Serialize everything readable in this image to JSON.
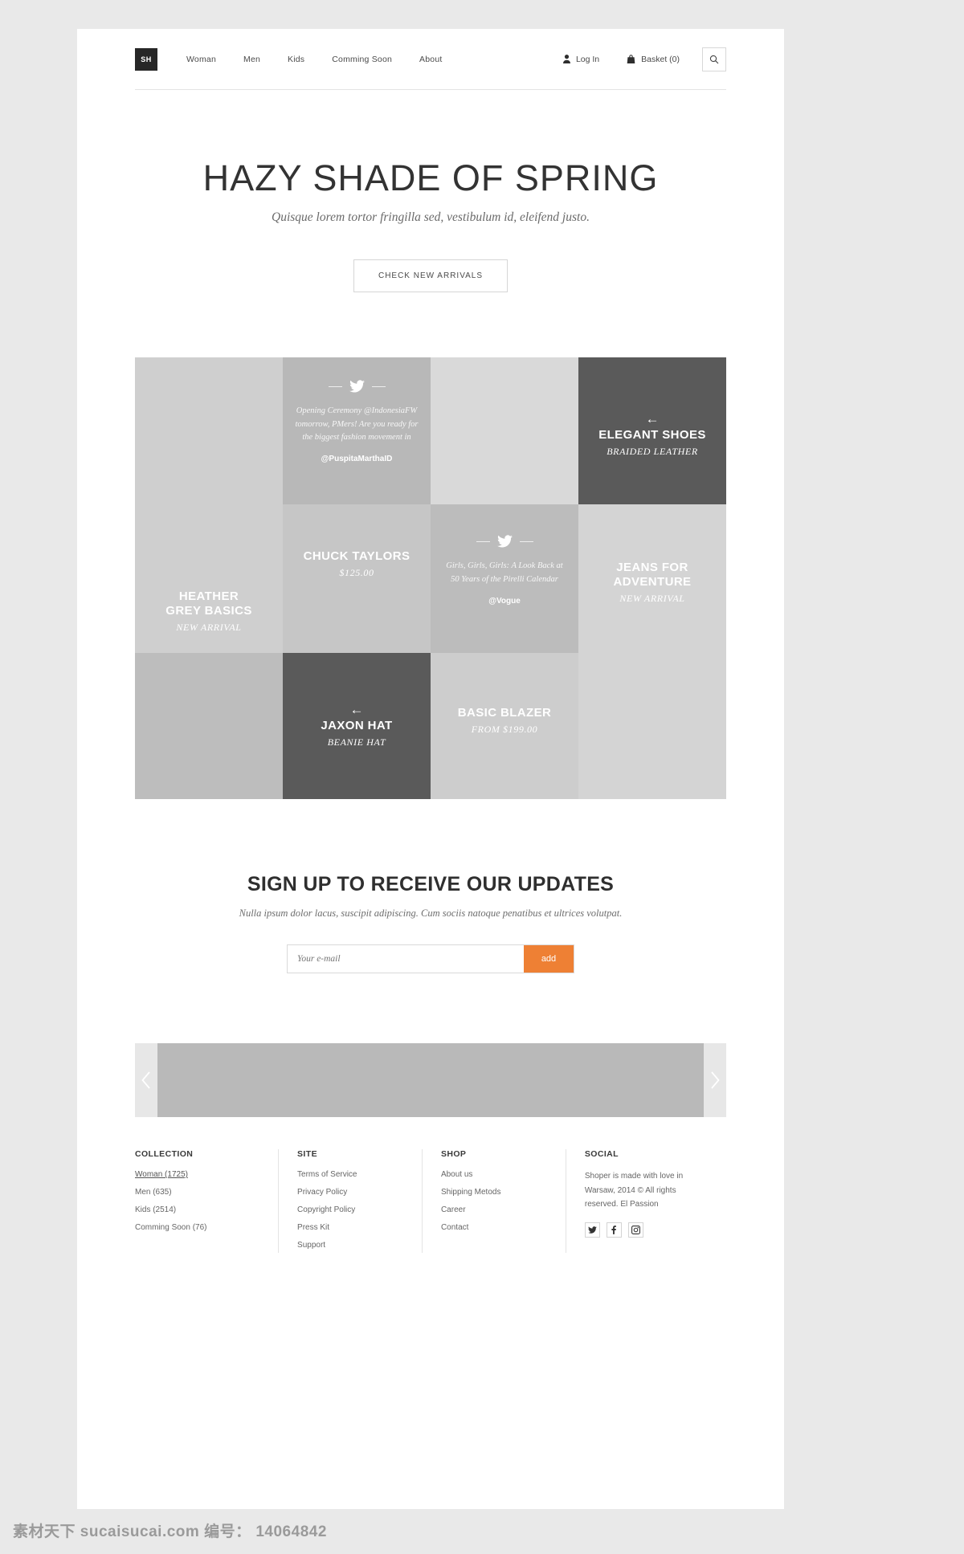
{
  "header": {
    "logo": "SH",
    "nav": [
      {
        "label": "Woman"
      },
      {
        "label": "Men"
      },
      {
        "label": "Kids"
      },
      {
        "label": "Comming Soon"
      },
      {
        "label": "About"
      }
    ],
    "login": "Log In",
    "basket": "Basket (0)",
    "search_icon": "search-icon"
  },
  "hero": {
    "title": "HAZY SHADE OF SPRING",
    "subtitle": "Quisque lorem tortor fringilla sed, vestibulum id, eleifend justo.",
    "cta": "CHECK NEW ARRIVALS"
  },
  "grid": {
    "heather": {
      "title_line1": "HEATHER",
      "title_line2": "GREY BASICS",
      "sub": "NEW ARRIVAL",
      "bg": "#cfcfcf"
    },
    "tweet1": {
      "body": "Opening Ceremony @IndonesiaFW tomorrow, PMers! Are you ready for the biggest fashion movement in",
      "handle": "@PuspitaMarthaID",
      "bg": "#b8b8b8"
    },
    "blank_top": {
      "bg": "#d9d9d9"
    },
    "shoes": {
      "arrow": "←",
      "title": "ELEGANT SHOES",
      "sub": "BRAIDED LEATHER",
      "bg": "#5a5a5a"
    },
    "chuck": {
      "title": "CHUCK TAYLORS",
      "sub": "$125.00",
      "bg": "#c6c6c6"
    },
    "tweet2": {
      "body": "Girls, Girls, Girls: A Look Back at 50 Years of the Pirelli Calendar",
      "handle": "@Vogue",
      "bg": "#bcbcbc"
    },
    "jeans": {
      "title_line1": "JEANS FOR",
      "title_line2": "ADVENTURE",
      "sub": "NEW ARRIVAL",
      "bg": "#d4d4d4"
    },
    "blank_bottom": {
      "bg": "#bdbdbd"
    },
    "jaxon": {
      "arrow": "←",
      "title": "JAXON HAT",
      "sub": "BEANIE HAT",
      "bg": "#5a5a5a"
    },
    "blazer": {
      "title": "BASIC BLAZER",
      "sub": "FROM $199.00",
      "bg": "#cdcdcd"
    }
  },
  "newsletter": {
    "title": "SIGN UP TO RECEIVE OUR UPDATES",
    "subtitle": "Nulla ipsum dolor lacus, suscipit adipiscing. Cum sociis natoque penatibus et ultrices volutpat.",
    "placeholder": "Your e-mail",
    "value": "",
    "button": "add",
    "accent": "#ee8034"
  },
  "carousel": {
    "prev": "‹",
    "next": "›"
  },
  "footer": {
    "collection": {
      "title": "COLLECTION",
      "items": [
        {
          "label": "Woman (1725)",
          "active": true
        },
        {
          "label": "Men (635)",
          "active": false
        },
        {
          "label": "Kids (2514)",
          "active": false
        },
        {
          "label": "Comming Soon (76)",
          "active": false
        }
      ]
    },
    "site": {
      "title": "SITE",
      "items": [
        {
          "label": "Terms of Service"
        },
        {
          "label": "Privacy Policy"
        },
        {
          "label": "Copyright Policy"
        },
        {
          "label": "Press Kit"
        },
        {
          "label": "Support"
        }
      ]
    },
    "shop": {
      "title": "SHOP",
      "items": [
        {
          "label": "About us"
        },
        {
          "label": "Shipping Metods"
        },
        {
          "label": "Career"
        },
        {
          "label": "Contact"
        }
      ]
    },
    "social": {
      "title": "SOCIAL",
      "text": "Shoper is made with love in Warsaw, 2014 © All rights reserved. El Passion",
      "icons": [
        "twitter-icon",
        "facebook-icon",
        "instagram-icon"
      ]
    }
  },
  "watermark": "素材天下 sucaisucai.com  编号： 14064842"
}
